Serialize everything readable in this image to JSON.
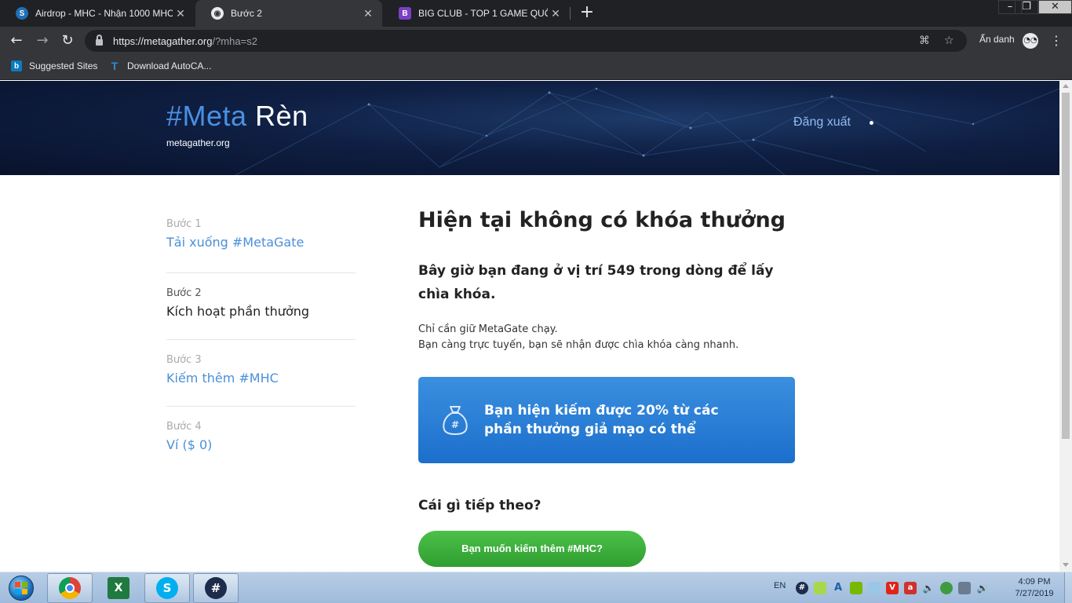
{
  "browser": {
    "tabs": [
      {
        "title": "Airdrop - MHC - Nhận 1000 MHC",
        "active": false
      },
      {
        "title": "Bước 2",
        "active": true
      },
      {
        "title": "BIG CLUB - TOP 1 GAME QUỐC TẾ",
        "active": false
      }
    ],
    "url_host": "https://metagather.org",
    "url_path": "/?mha=s2",
    "profile_label": "Ẩn danh",
    "bookmarks": [
      "Suggested Sites",
      "Download AutoCA..."
    ]
  },
  "site": {
    "title_hash": "#Meta",
    "title_rest": " Rèn",
    "subtitle": "metagather.org",
    "logout": "Đăng xuất"
  },
  "steps": [
    {
      "label": "Bước 1",
      "value": "Tải xuống #MetaGate"
    },
    {
      "label": "Bước 2",
      "value": "Kích hoạt phần thưởng"
    },
    {
      "label": "Bước 3",
      "value": "Kiếm thêm #MHC"
    },
    {
      "label": "Bước 4",
      "value": "Ví ($ 0)"
    }
  ],
  "main": {
    "heading": "Hiện tại không có khóa thưởng",
    "position_text": "Bây giờ bạn đang ở vị trí 549 trong dòng để lấy chìa khóa.",
    "note_line1": "Chỉ cần giữ MetaGate chạy.",
    "note_line2": "Bạn càng trực tuyến, bạn sẽ nhận được chìa khóa càng nhanh.",
    "promo_text": "Bạn hiện kiếm được 20% từ các phần thưởng giả mạo có thể",
    "next_heading": "Cái gì tiếp theo?",
    "cta_label": "Bạn muốn kiếm thêm #MHC?"
  },
  "taskbar": {
    "language": "EN",
    "time": "4:09 PM",
    "date": "7/27/2019"
  },
  "colors": {
    "accent_blue": "#4a90d9",
    "promo_blue": "#1b6fcc",
    "cta_green": "#2f9e30",
    "hero_dark": "#0f1f43"
  }
}
